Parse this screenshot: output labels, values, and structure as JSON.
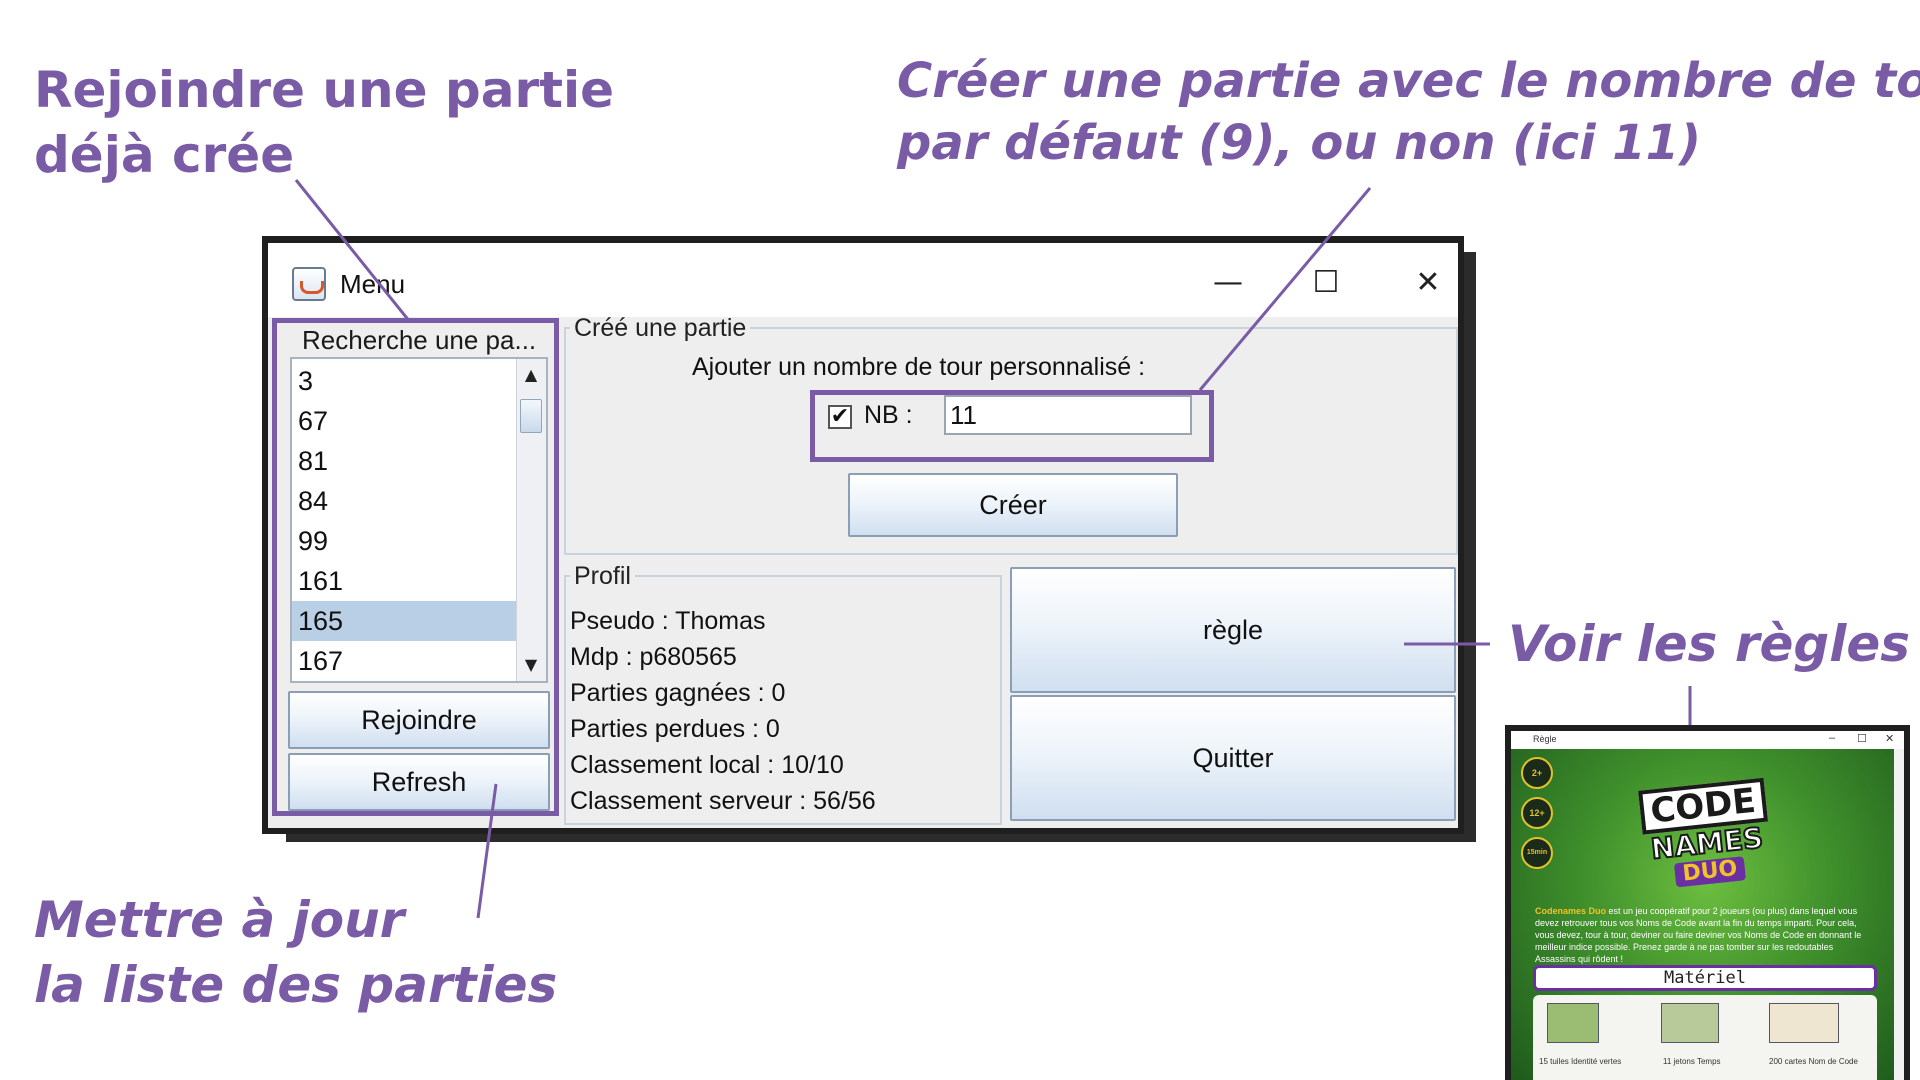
{
  "annotations": {
    "join": [
      "Rejoindre une partie",
      "déjà crée"
    ],
    "create": [
      "Créer une partie avec le nombre de tours",
      "par défaut (9), ou non (ici 11)"
    ],
    "rules": "Voir les règles",
    "refresh": [
      "Mettre à jour",
      "la liste des parties"
    ]
  },
  "window": {
    "title": "Menu",
    "minimize": "—",
    "maximize": "☐",
    "close": "✕"
  },
  "search": {
    "title": "Recherche une pa...",
    "items": [
      "3",
      "67",
      "81",
      "84",
      "99",
      "161",
      "165",
      "167"
    ],
    "selected_index": 6,
    "join_label": "Rejoindre",
    "refresh_label": "Refresh"
  },
  "create": {
    "legend": "Créé une partie",
    "custom_label": "Ajouter un nombre de tour personnalisé :",
    "checkbox_checked": "✔",
    "nb_label": "NB :",
    "nb_value": "11",
    "create_label": "Créer"
  },
  "profile": {
    "legend": "Profil",
    "lines": [
      "Pseudo : Thomas",
      "Mdp : p680565",
      "Parties gagnées : 0",
      "Parties perdues : 0",
      "Classement local : 10/10",
      "Classement serveur : 56/56"
    ]
  },
  "actions": {
    "rules_label": "règle",
    "quit_label": "Quitter"
  },
  "rules_window": {
    "title": "Règle",
    "badges": [
      "2+",
      "12+",
      "15min"
    ],
    "logo_top": "CODE",
    "logo_mid": "NAMES",
    "logo_duo": "DUO",
    "intro_brand": "Codenames Duo",
    "intro_text": " est un jeu coopératif pour 2 joueurs (ou plus) dans lequel vous devez retrouver tous vos Noms de Code avant la fin du temps imparti. Pour cela, vous devez, tour à tour, deviner ou faire deviner vos Noms de Code en donnant le meilleur indice possible. Prenez garde à ne pas tomber sur les redoutables Assassins qui rôdent !",
    "materiel": "Matériel",
    "materials": [
      "15 tuiles Identité vertes",
      "11 jetons Temps",
      "200 cartes Nom de Code"
    ]
  },
  "colors": {
    "accent": "#7a5ba6",
    "selection": "#b8cfe5",
    "window_bg": "#eeeeee"
  }
}
